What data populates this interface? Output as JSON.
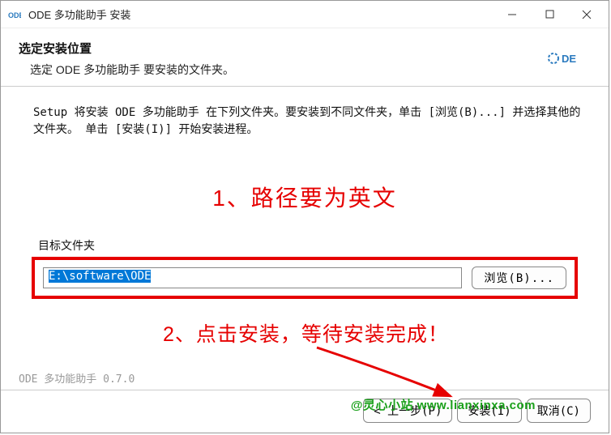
{
  "window": {
    "title": "ODE 多功能助手 安装"
  },
  "header": {
    "title": "选定安装位置",
    "subtitle": "选定 ODE 多功能助手 要安装的文件夹。",
    "logo_text": "DE"
  },
  "setup_text": "Setup 将安装 ODE 多功能助手 在下列文件夹。要安装到不同文件夹，单击 [浏览(B)...] 并选择其他的文件夹。 单击 [安装(I)] 开始安装进程。",
  "annotations": {
    "note1": "1、路径要为英文",
    "note2": "2、点击安装，等待安装完成！"
  },
  "dest": {
    "group_label": "目标文件夹",
    "path_value": "E:\\software\\ODE",
    "browse_label": "浏览(B)..."
  },
  "footer": {
    "version_text": "ODE 多功能助手 0.7.0",
    "back_label": "< 上一步(P)",
    "install_label": "安装(I)",
    "cancel_label": "取消(C)"
  },
  "watermark": "@灵心小站  www.lianxinxa.com"
}
